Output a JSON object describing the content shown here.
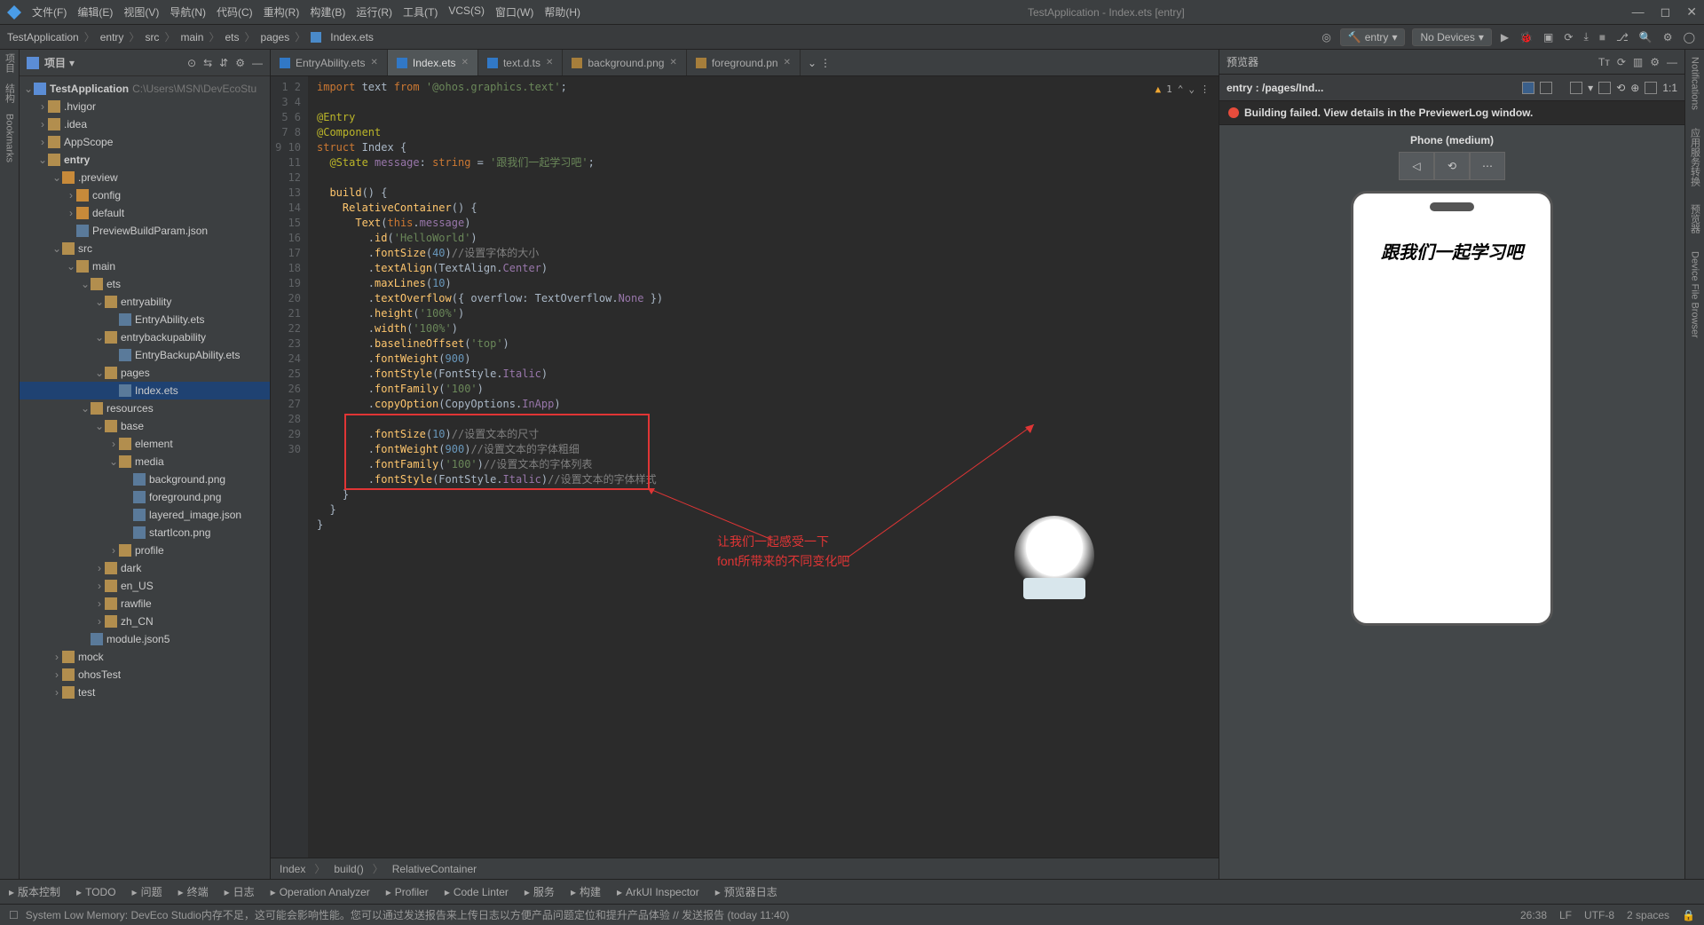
{
  "title": "TestApplication - Index.ets [entry]",
  "menu": [
    "文件(F)",
    "编辑(E)",
    "视图(V)",
    "导航(N)",
    "代码(C)",
    "重构(R)",
    "构建(B)",
    "运行(R)",
    "工具(T)",
    "VCS(S)",
    "窗口(W)",
    "帮助(H)"
  ],
  "breadcrumbs": [
    "TestApplication",
    "entry",
    "src",
    "main",
    "ets",
    "pages",
    "Index.ets"
  ],
  "nav": {
    "module": "entry",
    "device": "No Devices"
  },
  "project": {
    "label": "项目",
    "root": "TestApplication",
    "root_path": "C:\\Users\\MSN\\DevEcoStu",
    "tree": [
      {
        "d": 1,
        "t": "f",
        "n": ".hvigor"
      },
      {
        "d": 1,
        "t": "f",
        "n": ".idea"
      },
      {
        "d": 1,
        "t": "f",
        "n": "AppScope"
      },
      {
        "d": 1,
        "t": "fo",
        "n": "entry",
        "bold": true
      },
      {
        "d": 2,
        "t": "fo",
        "n": ".preview",
        "orange": true
      },
      {
        "d": 3,
        "t": "f",
        "n": "config",
        "orange": true
      },
      {
        "d": 3,
        "t": "f",
        "n": "default",
        "orange": true
      },
      {
        "d": 3,
        "t": "file",
        "n": "PreviewBuildParam.json"
      },
      {
        "d": 2,
        "t": "fo",
        "n": "src"
      },
      {
        "d": 3,
        "t": "fo",
        "n": "main"
      },
      {
        "d": 4,
        "t": "fo",
        "n": "ets"
      },
      {
        "d": 5,
        "t": "fo",
        "n": "entryability"
      },
      {
        "d": 6,
        "t": "file",
        "n": "EntryAbility.ets"
      },
      {
        "d": 5,
        "t": "fo",
        "n": "entrybackupability"
      },
      {
        "d": 6,
        "t": "file",
        "n": "EntryBackupAbility.ets"
      },
      {
        "d": 5,
        "t": "fo",
        "n": "pages"
      },
      {
        "d": 6,
        "t": "file",
        "n": "Index.ets",
        "sel": true
      },
      {
        "d": 4,
        "t": "fo",
        "n": "resources"
      },
      {
        "d": 5,
        "t": "fo",
        "n": "base"
      },
      {
        "d": 6,
        "t": "f",
        "n": "element"
      },
      {
        "d": 6,
        "t": "fo",
        "n": "media"
      },
      {
        "d": 7,
        "t": "file",
        "n": "background.png"
      },
      {
        "d": 7,
        "t": "file",
        "n": "foreground.png"
      },
      {
        "d": 7,
        "t": "file",
        "n": "layered_image.json"
      },
      {
        "d": 7,
        "t": "file",
        "n": "startIcon.png"
      },
      {
        "d": 6,
        "t": "f",
        "n": "profile"
      },
      {
        "d": 5,
        "t": "f",
        "n": "dark"
      },
      {
        "d": 5,
        "t": "f",
        "n": "en_US"
      },
      {
        "d": 5,
        "t": "f",
        "n": "rawfile"
      },
      {
        "d": 5,
        "t": "f",
        "n": "zh_CN"
      },
      {
        "d": 4,
        "t": "file",
        "n": "module.json5"
      },
      {
        "d": 2,
        "t": "f",
        "n": "mock"
      },
      {
        "d": 2,
        "t": "f",
        "n": "ohosTest"
      },
      {
        "d": 2,
        "t": "f",
        "n": "test"
      }
    ]
  },
  "tabs": [
    {
      "n": "EntryAbility.ets",
      "icon": "ts"
    },
    {
      "n": "Index.ets",
      "icon": "ts",
      "active": true
    },
    {
      "n": "text.d.ts",
      "icon": "ts"
    },
    {
      "n": "background.png",
      "icon": "img"
    },
    {
      "n": "foreground.pn",
      "icon": "img"
    }
  ],
  "code_warning": "1",
  "code_lines": [
    {
      "n": 1,
      "h": "<span class='k-orange'>import</span> text <span class='k-orange'>from</span> <span class='k-green'>'@ohos.graphics.text'</span>;"
    },
    {
      "n": 2,
      "h": ""
    },
    {
      "n": 3,
      "h": "<span class='k-dec'>@Entry</span>"
    },
    {
      "n": 4,
      "h": "<span class='k-dec'>@Component</span>"
    },
    {
      "n": 5,
      "h": "<span class='k-orange'>struct</span> <span class='k-white'>Index</span> {"
    },
    {
      "n": 6,
      "h": "  <span class='k-dec'>@State</span> <span class='k-purple'>message</span>: <span class='k-orange'>string</span> = <span class='k-green'>'跟我们一起学习吧'</span>;"
    },
    {
      "n": 7,
      "h": ""
    },
    {
      "n": 8,
      "h": "  <span class='k-yellow'>build</span>() {"
    },
    {
      "n": 9,
      "h": "    <span class='k-yellow'>RelativeContainer</span>() {"
    },
    {
      "n": 10,
      "h": "      <span class='k-yellow'>Text</span>(<span class='k-orange'>this</span>.<span class='k-purple'>message</span>)"
    },
    {
      "n": 11,
      "h": "        .<span class='k-yellow'>id</span>(<span class='k-green'>'HelloWorld'</span>)"
    },
    {
      "n": 12,
      "h": "        .<span class='k-yellow'>fontSize</span>(<span class='k-blue'>40</span>)<span class='k-gray'>//设置字体的大小</span>"
    },
    {
      "n": 13,
      "h": "        .<span class='k-yellow'>textAlign</span>(TextAlign.<span class='k-purple'>Center</span>)"
    },
    {
      "n": 14,
      "h": "        .<span class='k-yellow'>maxLines</span>(<span class='k-blue'>10</span>)"
    },
    {
      "n": 15,
      "h": "        .<span class='k-yellow'>textOverflow</span>({ overflow: TextOverflow.<span class='k-purple'>None</span> })"
    },
    {
      "n": 16,
      "h": "        .<span class='k-yellow'>height</span>(<span class='k-green'>'100%'</span>)"
    },
    {
      "n": 17,
      "h": "        .<span class='k-yellow'>width</span>(<span class='k-green'>'100%'</span>)"
    },
    {
      "n": 18,
      "h": "        .<span class='k-yellow'>baselineOffset</span>(<span class='k-green'>'top'</span>)"
    },
    {
      "n": 19,
      "h": "        .<span class='k-yellow'>fontWeight</span>(<span class='k-blue'>900</span>)"
    },
    {
      "n": 20,
      "h": "        .<span class='k-yellow'>fontStyle</span>(FontStyle.<span class='k-purple'>Italic</span>)"
    },
    {
      "n": 21,
      "h": "        .<span class='k-yellow'>fontFamily</span>(<span class='k-green'>'100'</span>)"
    },
    {
      "n": 22,
      "h": "        .<span class='k-yellow'>copyOption</span>(CopyOptions.<span class='k-purple'>InApp</span>)"
    },
    {
      "n": 23,
      "h": ""
    },
    {
      "n": 24,
      "h": "        .<span class='k-yellow'>fontSize</span>(<span class='k-blue'>10</span>)<span class='k-gray'>//设置文本的尺寸</span>"
    },
    {
      "n": 25,
      "h": "        .<span class='k-yellow'>fontWeight</span>(<span class='k-blue'>900</span>)<span class='k-gray'>//设置文本的字体粗细</span>"
    },
    {
      "n": 26,
      "h": "        .<span class='k-yellow'>fontFamily</span>(<span class='k-green'>'100'</span>)<span class='k-gray'>//设置文本的字体列表</span>"
    },
    {
      "n": 27,
      "h": "        .<span class='k-yellow'>fontStyle</span>(FontStyle.<span class='k-purple'>Italic</span>)<span class='k-gray'>//设置文本的字体样式</span>"
    },
    {
      "n": 28,
      "h": "    }"
    },
    {
      "n": 29,
      "h": "  }"
    },
    {
      "n": 30,
      "h": "}"
    }
  ],
  "editor_footer": [
    "Index",
    "build()",
    "RelativeContainer"
  ],
  "annotation": {
    "line1": "让我们一起感受一下",
    "line2": "font所带来的不同变化吧"
  },
  "previewer": {
    "title": "预览器",
    "sub": "entry : /pages/Ind...",
    "error": "Building failed. View details in the PreviewerLog window.",
    "phone_label": "Phone (medium)",
    "phone_text": "跟我们一起学习吧"
  },
  "left_tools": [
    "项目",
    "结构",
    "Bookmarks"
  ],
  "right_tools": [
    "Notifications",
    "应用服务转换",
    "预览器",
    "Device File Browser"
  ],
  "bottom": [
    "版本控制",
    "TODO",
    "问题",
    "终端",
    "日志",
    "Operation Analyzer",
    "Profiler",
    "Code Linter",
    "服务",
    "构建",
    "ArkUI Inspector",
    "预览器日志"
  ],
  "status": {
    "msg": "System Low Memory: DevEco Studio内存不足，这可能会影响性能。您可以通过发送报告来上传日志以方便产品问题定位和提升产品体验 // 发送报告 (today 11:40)",
    "pos": "26:38",
    "sep": "LF",
    "enc": "UTF-8",
    "ind": "2 spaces"
  }
}
